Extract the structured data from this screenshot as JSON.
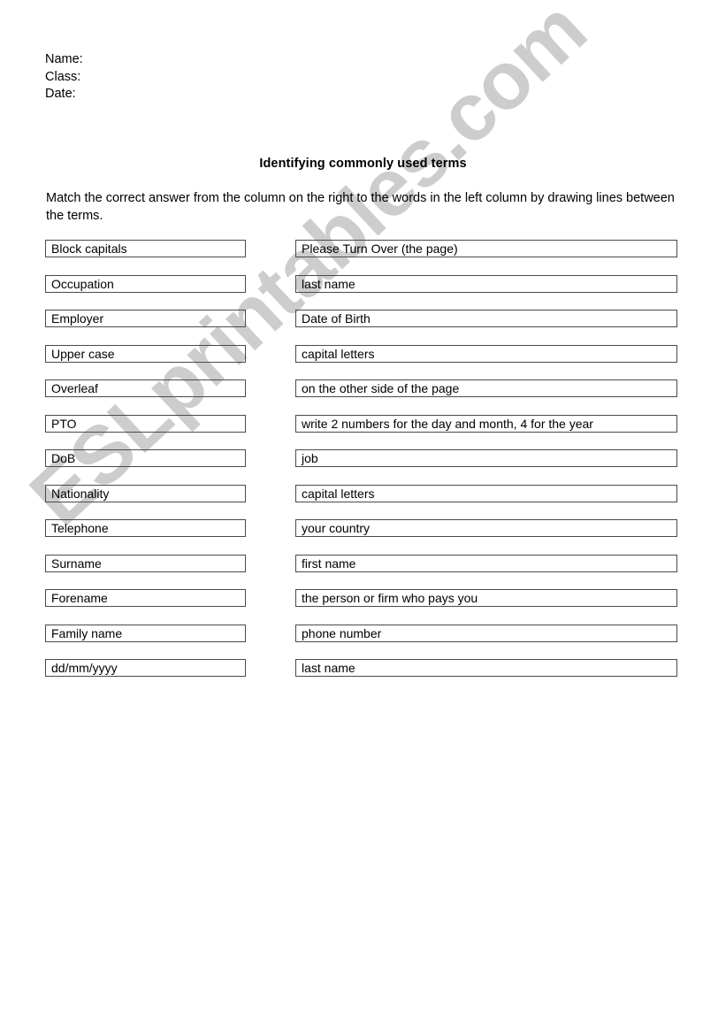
{
  "header": {
    "fields": [
      "Name:",
      "Class:",
      "Date:"
    ]
  },
  "title": "Identifying commonly used terms",
  "instructions": "Match the correct answer from the column on the right to the words in the left column by drawing lines between the terms.",
  "watermark": {
    "text": "ESLprintables.com",
    "color": "#cdcdcd"
  },
  "colors": {
    "page_background": "#ffffff",
    "text": "#000000",
    "box_border": "#4a4a4a"
  },
  "matching": {
    "terms": [
      "Block capitals",
      "Occupation",
      "Employer",
      "Upper case",
      "Overleaf",
      "PTO",
      "DoB",
      "Nationality",
      "Telephone",
      "Surname",
      "Forename",
      "Family name",
      "dd/mm/yyyy"
    ],
    "answers": [
      "Please Turn Over (the page)",
      "last name",
      "Date of Birth",
      "capital letters",
      "on the other side of the page",
      "write 2 numbers for the day and month, 4 for the year",
      "job",
      "capital letters",
      "your country",
      "first name",
      "the person or firm who pays you",
      "phone number",
      "last name"
    ]
  }
}
